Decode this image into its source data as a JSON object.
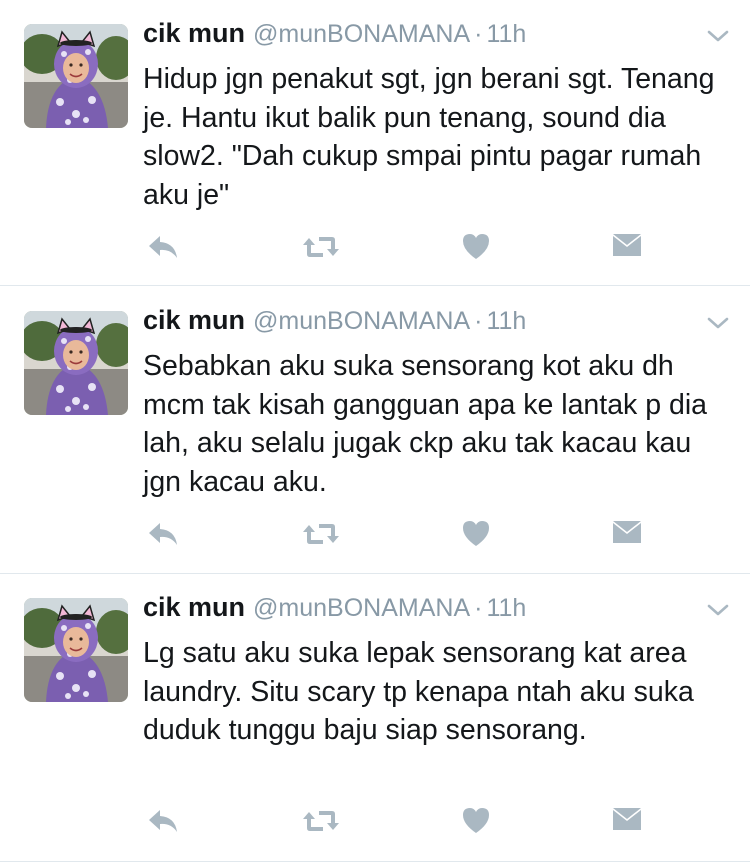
{
  "colors": {
    "text_primary": "#14171a",
    "text_secondary": "#8899a6",
    "icon_gray": "#aab8c2",
    "divider": "#e1e8ed"
  },
  "icons": {
    "reply": "reply-icon",
    "retweet": "retweet-icon",
    "like": "heart-icon",
    "dm": "envelope-icon",
    "caret": "chevron-down-icon"
  },
  "tweets": [
    {
      "name": "cik mun",
      "handle": "@munBONAMANA",
      "separator": "·",
      "time": "11h",
      "text": "Hidup jgn penakut sgt, jgn berani sgt. Tenang je. Hantu ikut balik pun tenang, sound dia slow2. \"Dah cukup smpai pintu pagar rumah aku je\""
    },
    {
      "name": "cik mun",
      "handle": "@munBONAMANA",
      "separator": "·",
      "time": "11h",
      "text": "Sebabkan aku suka sensorang kot aku dh mcm tak kisah gangguan apa ke lantak p dia lah, aku selalu jugak ckp aku tak kacau kau jgn kacau aku."
    },
    {
      "name": "cik mun",
      "handle": "@munBONAMANA",
      "separator": "·",
      "time": "11h",
      "text": "Lg satu aku suka lepak sensorang kat area laundry. Situ scary tp kenapa ntah aku suka duduk tunggu baju siap sensorang."
    }
  ]
}
